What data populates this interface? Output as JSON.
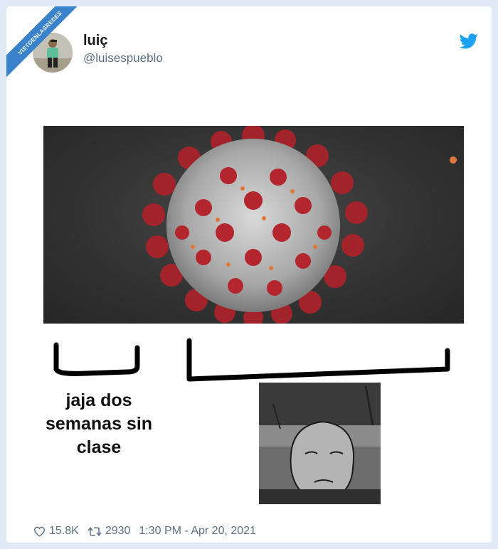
{
  "watermark": {
    "text": "VISTOENLASREDES"
  },
  "tweet": {
    "author_name": "luiç",
    "author_handle": "@luisespueblo"
  },
  "meme": {
    "caption_lines": [
      "jaja dos",
      "semanas sin",
      "clase"
    ]
  },
  "footer": {
    "likes": "15.8K",
    "retweets": "2930",
    "timestamp": "1:30 PM - Apr 20, 2021"
  },
  "icons": {
    "brand": "twitter-bird-icon",
    "like": "heart-icon",
    "retweet": "retweet-icon"
  },
  "colors": {
    "twitter_blue": "#1da1f2",
    "banner_blue": "#3a82c9",
    "muted_text": "#5b7083"
  }
}
